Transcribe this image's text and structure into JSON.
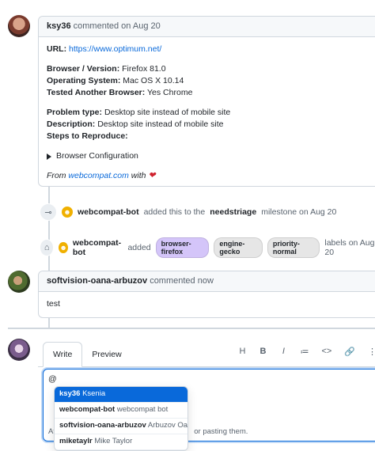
{
  "comment1": {
    "author": "ksy36",
    "action": "commented on Aug 20",
    "url_label": "URL:",
    "url": "https://www.optimum.net/",
    "browser_label": "Browser / Version:",
    "browser": "Firefox 81.0",
    "os_label": "Operating System:",
    "os": "Mac OS X 10.14",
    "tested_label": "Tested Another Browser:",
    "tested": "Yes Chrome",
    "problem_label": "Problem type:",
    "problem": "Desktop site instead of mobile site",
    "description_label": "Description:",
    "description": "Desktop site instead of mobile site",
    "steps_label": "Steps to Reproduce:",
    "details_summary": "Browser Configuration",
    "from_prefix": "From",
    "from_link": "webcompat.com",
    "from_suffix": "with"
  },
  "event1": {
    "icon": "milestone-icon",
    "actor": "webcompat-bot",
    "text_before": "added this to the",
    "milestone": "needstriage",
    "text_after": "milestone on Aug 20"
  },
  "event2": {
    "icon": "tag-icon",
    "actor": "webcompat-bot",
    "text_before": "added",
    "labels": [
      {
        "name": "browser-firefox",
        "color": "#d4c5f9"
      },
      {
        "name": "engine-gecko",
        "color": "#e6e6e6"
      },
      {
        "name": "priority-normal",
        "color": "#e6e6e6"
      }
    ],
    "text_after": "labels on Aug 20"
  },
  "comment2": {
    "author": "softvision-oana-arbuzov",
    "action": "commented now",
    "body": "test"
  },
  "editor": {
    "tabs": [
      "Write",
      "Preview"
    ],
    "active_tab": "Write",
    "toolbar": [
      "H",
      "B",
      "I",
      "≔",
      "<>",
      "🔗",
      "⋮"
    ],
    "input_value": "@",
    "hint_prefix": "At",
    "hint_suffix": "or pasting them."
  },
  "suggestions": [
    {
      "login": "ksy36",
      "name": "Ksenia",
      "active": true
    },
    {
      "login": "webcompat-bot",
      "name": "webcompat bot",
      "active": false
    },
    {
      "login": "softvision-oana-arbuzov",
      "name": "Arbuzov Oana",
      "active": false
    },
    {
      "login": "miketaylr",
      "name": "Mike Taylor",
      "active": false
    }
  ],
  "colors": {
    "link": "#0969da",
    "heart": "#cf222e",
    "bot": "#f0b000"
  }
}
